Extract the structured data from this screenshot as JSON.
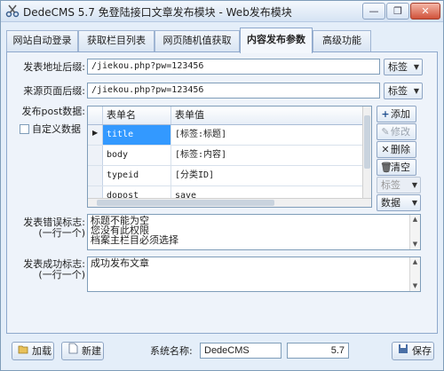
{
  "window": {
    "title": "DedeCMS 5.7 免登陆接口文章发布模块 - Web发布模块",
    "minimize": "—",
    "restore": "❐",
    "close": "✕"
  },
  "tabs": [
    {
      "label": "网站自动登录",
      "active": false
    },
    {
      "label": "获取栏目列表",
      "active": false
    },
    {
      "label": "网页随机值获取",
      "active": false
    },
    {
      "label": "内容发布参数",
      "active": true
    },
    {
      "label": "高级功能",
      "active": false
    }
  ],
  "form": {
    "post_url_label": "发表地址后缀:",
    "post_url_value": "/jiekou.php?pw=123456",
    "post_url_tag": "标签",
    "referer_label": "来源页面后缀:",
    "referer_value": "/jiekou.php?pw=123456",
    "referer_tag": "标签",
    "post_data_label": "发布post数据:",
    "custom_data_label": "自定义数据"
  },
  "grid": {
    "columns": [
      "表单名",
      "表单值"
    ],
    "rows": [
      {
        "name": "title",
        "value": "[标签:标题]",
        "selected": true
      },
      {
        "name": "body",
        "value": "[标签:内容]",
        "selected": false
      },
      {
        "name": "typeid",
        "value": "[分类ID]",
        "selected": false
      },
      {
        "name": "dopost",
        "value": "save",
        "selected": false
      }
    ]
  },
  "side_buttons": {
    "add": "添加",
    "edit": "修改",
    "delete": "删除",
    "clear": "清空",
    "tag": "标签",
    "data": "数据"
  },
  "error_flag": {
    "label": "发表错误标志:",
    "hint": "(一行一个)",
    "lines": [
      "标题不能为空",
      "您没有此权限",
      "档案主栏目必须选择"
    ]
  },
  "success_flag": {
    "label": "发表成功标志:",
    "hint": "(一行一个)",
    "lines": [
      "成功发布文章"
    ]
  },
  "footer": {
    "load_label": "加载",
    "new_label": "新建",
    "system_name_label": "系统名称:",
    "system_name_value": "DedeCMS",
    "version_value": "5.7",
    "save_label": "保存"
  },
  "colors": {
    "selection": "#3399ff",
    "window_bg": "#e4eef9",
    "close_button": "#d0523a"
  },
  "icons": {
    "add": "plus-icon",
    "edit": "pencil-icon",
    "delete": "x-icon",
    "clear": "trash-icon",
    "load": "folder-open-icon",
    "new": "new-file-icon",
    "save": "save-icon",
    "app": "scissors-icon"
  }
}
